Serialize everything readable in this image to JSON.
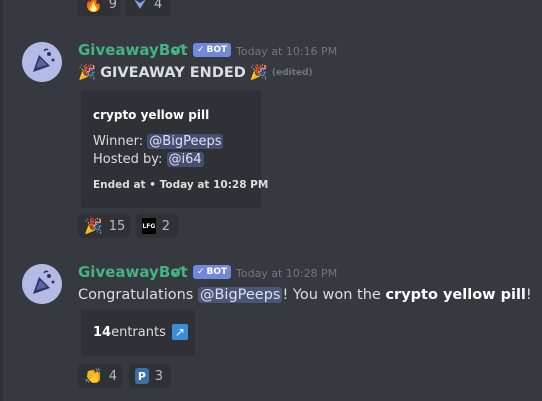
{
  "top_reactions": [
    {
      "emoji": "🔥",
      "count": "9"
    },
    {
      "emoji": "🪽",
      "count": "4"
    }
  ],
  "message1": {
    "username": "GiveawayBot",
    "verified_mark": "✓",
    "bot_tag": "BOT",
    "bot_check": "✓",
    "timestamp": "Today at 10:16 PM",
    "heading": "GIVEAWAY ENDED",
    "heading_emoji": "🎉",
    "edited": "(edited)",
    "embed": {
      "title": "crypto yellow pill",
      "winner_label": "Winner:",
      "winner": "@BigPeeps",
      "host_label": "Hosted by:",
      "host": "@i64",
      "footer": "Ended at • Today at 10:28 PM"
    },
    "reactions": [
      {
        "emoji": "🎉",
        "count": "15"
      },
      {
        "emoji": "LFG",
        "count": "2"
      }
    ]
  },
  "message2": {
    "username": "GiveawayBot",
    "verified_mark": "✓",
    "bot_tag": "BOT",
    "bot_check": "✓",
    "timestamp": "Today at 10:28 PM",
    "text_before": "Congratulations ",
    "mention": "@BigPeeps",
    "text_middle": "! You won the ",
    "prize": "crypto yellow pill",
    "text_after": "!",
    "embed": {
      "entrants_count": "14",
      "entrants_label": " entrants",
      "link_icon": "↗"
    },
    "reactions": [
      {
        "emoji": "👏",
        "count": "4"
      },
      {
        "emoji": "P",
        "count": "3"
      }
    ]
  },
  "colors": {
    "background": "#36393f",
    "embed": "#2f3136",
    "username": "#43b581",
    "bot_tag": "#7289da",
    "mention_bg": "#4a5085"
  }
}
